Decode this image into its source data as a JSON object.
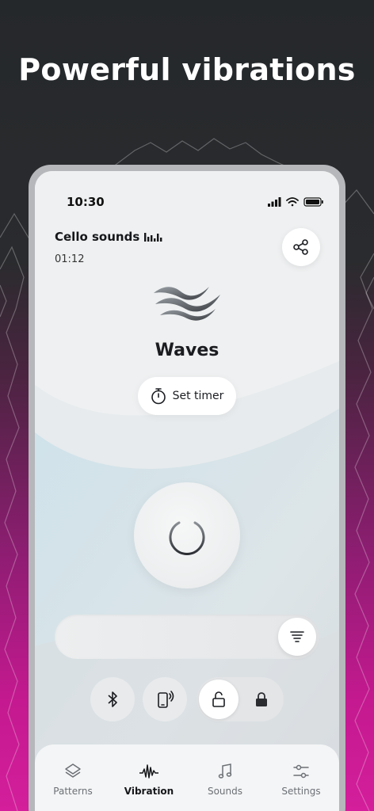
{
  "headline": "Powerful vibrations",
  "status_bar": {
    "time": "10:30"
  },
  "now_playing": {
    "title": "Cello sounds",
    "elapsed": "01:12"
  },
  "mode": {
    "name": "Waves"
  },
  "timer_button": {
    "label": "Set timer"
  },
  "intensity_slider": {
    "level": 1.0
  },
  "lock": {
    "selected": "unlocked"
  },
  "tabs": [
    {
      "label": "Patterns",
      "icon": "layers-icon",
      "active": false
    },
    {
      "label": "Vibration",
      "icon": "vibration-wave-icon",
      "active": true
    },
    {
      "label": "Sounds",
      "icon": "music-note-icon",
      "active": false
    },
    {
      "label": "Settings",
      "icon": "sliders-icon",
      "active": false
    }
  ],
  "colors": {
    "background_top": "#25282b",
    "background_bottom": "#d41e9b",
    "screen_bg": "#eef0f1",
    "accent_blue": "#cfe3ea",
    "text_primary": "#1b1d21"
  }
}
